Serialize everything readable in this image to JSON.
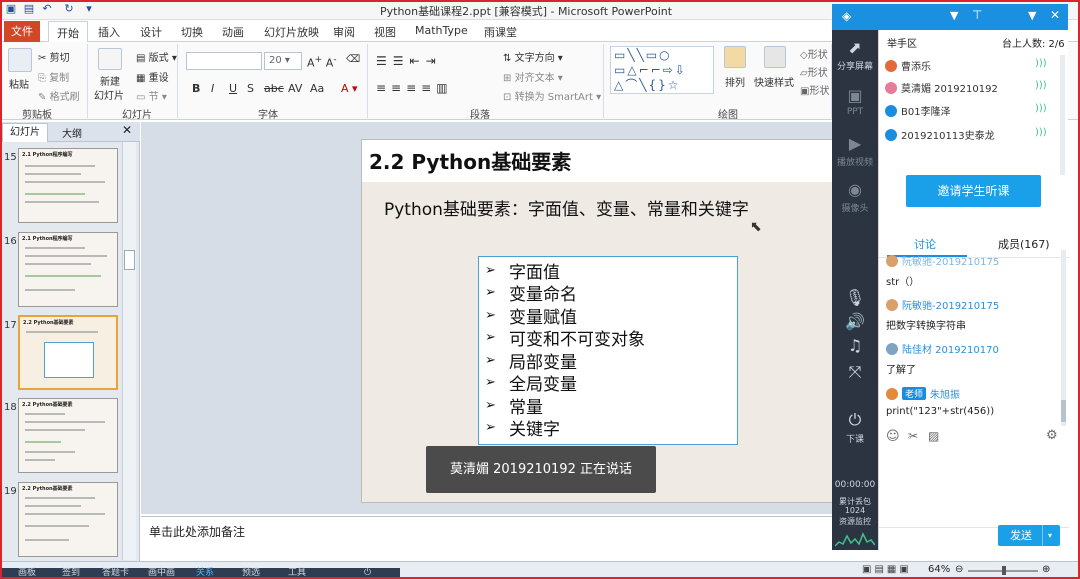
{
  "window": {
    "title": "Python基础课程2.ppt [兼容模式] - Microsoft PowerPoint"
  },
  "ribbon": {
    "file_tab": "文件",
    "tabs": [
      "开始",
      "插入",
      "设计",
      "切换",
      "动画",
      "幻灯片放映",
      "审阅",
      "视图",
      "MathType",
      "雨课堂"
    ],
    "active_tab": "开始",
    "clipboard": {
      "paste": "粘贴",
      "cut": "剪切",
      "copy": "复制",
      "format_painter": "格式刷",
      "label": "剪贴板"
    },
    "slides": {
      "new_slide_1": "新建",
      "new_slide_2": "幻灯片",
      "layout": "版式",
      "reset": "重设",
      "section": "节",
      "label": "幻灯片"
    },
    "font": {
      "size": "20",
      "label": "字体"
    },
    "paragraph": {
      "text_direction": "文字方向",
      "align_text": "对齐文本",
      "smartart": "转换为 SmartArt",
      "label": "段落"
    },
    "drawing": {
      "arrange": "排列",
      "quick_styles": "快速样式",
      "shape_fill": "形状",
      "shape_outline": "形状",
      "shape_effects": "形状",
      "label": "绘图"
    }
  },
  "slide_panel": {
    "tabs": [
      "幻灯片",
      "大纲"
    ],
    "thumbnails": [
      {
        "num": "15",
        "title": "2.1 Python程序编写"
      },
      {
        "num": "16",
        "title": "2.1 Python程序编写"
      },
      {
        "num": "17",
        "title": "2.2 Python基础要素"
      },
      {
        "num": "18",
        "title": "2.2 Python基础要素"
      },
      {
        "num": "19",
        "title": "2.2 Python基础要素"
      }
    ],
    "selected": "17"
  },
  "slide": {
    "title": "2.2 Python基础要素",
    "subtitle": "Python基础要素：字面值、变量、常量和关键字",
    "bullets": [
      "字面值",
      "变量命名",
      "变量赋值",
      "可变和不可变对象",
      "局部变量",
      "全局变量",
      "常量",
      "关键字"
    ]
  },
  "speaking": "莫清媚 2019210192 正在说话",
  "notes": {
    "placeholder": "单击此处添加备注"
  },
  "status": {
    "zoom": "64%"
  },
  "taskbar": {
    "items": [
      "画板",
      "签到",
      "答题卡",
      "画中画",
      "关系",
      "预选",
      "工具"
    ]
  },
  "sidebar": {
    "items": [
      {
        "label": "分享屏幕",
        "icon": "share-screen-icon"
      },
      {
        "label": "PPT",
        "icon": "ppt-icon"
      },
      {
        "label": "播放视频",
        "icon": "video-icon"
      },
      {
        "label": "摄像头",
        "icon": "camera-icon"
      }
    ],
    "end_class": "下课",
    "timer": "00:00:00",
    "stats_1": "累计丢包",
    "stats_2": "1024",
    "stats_3": "资源监控"
  },
  "chat": {
    "raise_hand": "举手区",
    "on_stage": "台上人数: 2/6",
    "members": [
      {
        "name": "曹添乐",
        "color": "#e26a3a"
      },
      {
        "name": "莫清媚 2019210192",
        "color": "#e77b9a"
      },
      {
        "name": "B01李隆泽",
        "color": "#1a8de0"
      },
      {
        "name": "2019210113史泰龙",
        "color": "#1a8de0"
      }
    ],
    "invite": "邀请学生听课",
    "tabs": [
      "讨论",
      "成员(167)"
    ],
    "messages": [
      {
        "name": "阮敏驰-2019210175",
        "text": "str（）"
      },
      {
        "name": "阮敏驰-2019210175",
        "text": "把数字转换字符串"
      },
      {
        "name": "陆佳材 2019210170",
        "text": "了解了"
      },
      {
        "name": "朱旭振",
        "text": "print(\"123\"+str(456))",
        "teacher": "老师"
      }
    ],
    "send": "发送"
  },
  "colors": {
    "accent": "#1a8de0",
    "file_tab": "#d24726",
    "frame": "#d8262b"
  }
}
